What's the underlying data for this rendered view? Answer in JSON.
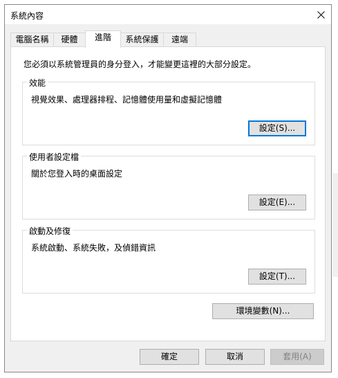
{
  "window": {
    "title": "系統內容"
  },
  "tabs": [
    {
      "label": "電腦名稱"
    },
    {
      "label": "硬體"
    },
    {
      "label": "進階"
    },
    {
      "label": "系統保護"
    },
    {
      "label": "遠端"
    }
  ],
  "active_tab": "進階",
  "panel": {
    "intro": "您必須以系統管理員的身分登入，才能變更這裡的大部分設定。",
    "groups": [
      {
        "title": "效能",
        "description": "視覺效果、處理器排程、記憶體使用量和虛擬記憶體",
        "button": "設定(S)..."
      },
      {
        "title": "使用者設定檔",
        "description": "關於您登入時的桌面設定",
        "button": "設定(E)..."
      },
      {
        "title": "啟動及修復",
        "description": "系統啟動、系統失敗，及偵錯資訊",
        "button": "設定(T)..."
      }
    ],
    "env_button": "環境變數(N)..."
  },
  "footer": {
    "ok": "確定",
    "cancel": "取消",
    "apply": "套用(A)"
  },
  "colors": {
    "accent": "#0078d7",
    "window_bg": "#f0f0f0",
    "panel_bg": "#ffffff",
    "disabled_text": "#838383"
  }
}
